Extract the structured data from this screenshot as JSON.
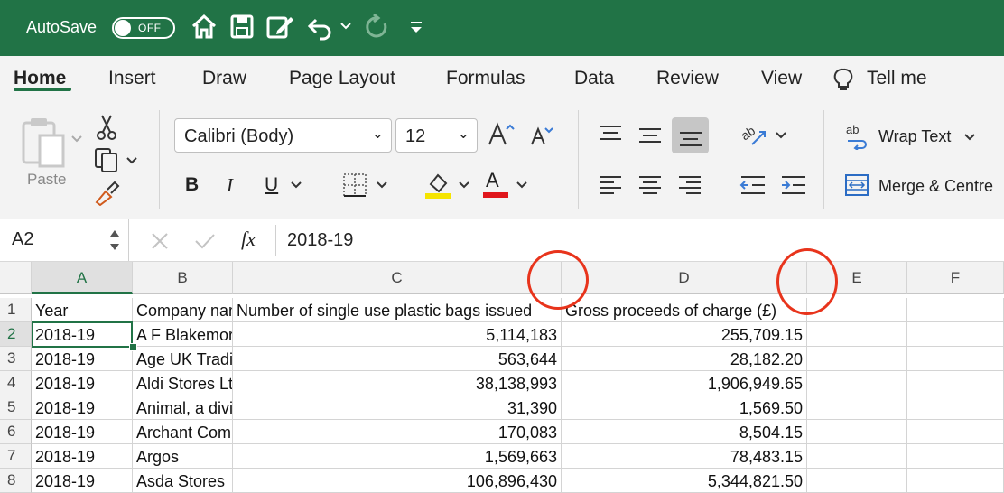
{
  "titlebar": {
    "autosave_label": "AutoSave",
    "autosave_state": "OFF",
    "quick_access_icons": [
      "home-icon",
      "save-icon",
      "edit-icon",
      "undo-icon",
      "redo-icon",
      "customize-icon"
    ]
  },
  "tabs": [
    "Home",
    "Insert",
    "Draw",
    "Page Layout",
    "Formulas",
    "Data",
    "Review",
    "View",
    "Tell me"
  ],
  "active_tab": "Home",
  "ribbon": {
    "paste_label": "Paste",
    "font_name": "Calibri (Body)",
    "font_size": "12",
    "wrap_text_label": "Wrap Text",
    "merge_label": "Merge & Centre",
    "bold": "B",
    "italic": "I",
    "underline": "U",
    "font_color_letter": "A",
    "highlight_color": "#f5e400",
    "font_color": "#e0161c"
  },
  "formula_bar": {
    "name_box": "A2",
    "fx": "fx",
    "value": "2018-19"
  },
  "sheet": {
    "columns": [
      "A",
      "B",
      "C",
      "D",
      "E",
      "F"
    ],
    "selected_column": "A",
    "rows": [
      {
        "num": "1",
        "cells": [
          "Year",
          "Company name",
          "Number of single use plastic bags issued",
          "Gross proceeds of charge (£)"
        ]
      },
      {
        "num": "2",
        "cells": [
          "2018-19",
          "A F Blakemore",
          "5,114,183",
          "255,709.15"
        ]
      },
      {
        "num": "3",
        "cells": [
          "2018-19",
          "Age UK Trading",
          "563,644",
          "28,182.20"
        ]
      },
      {
        "num": "4",
        "cells": [
          "2018-19",
          "Aldi Stores Ltd",
          "38,138,993",
          "1,906,949.65"
        ]
      },
      {
        "num": "5",
        "cells": [
          "2018-19",
          "Animal, a division",
          "31,390",
          "1,569.50"
        ]
      },
      {
        "num": "6",
        "cells": [
          "2018-19",
          "Archant Community",
          "170,083",
          "8,504.15"
        ]
      },
      {
        "num": "7",
        "cells": [
          "2018-19",
          "Argos",
          "1,569,663",
          "78,483.15"
        ]
      },
      {
        "num": "8",
        "cells": [
          "2018-19",
          "Asda Stores",
          "106,896,430",
          "5,344,821.50"
        ]
      }
    ],
    "selected_row": "2"
  },
  "annotation_color": "#e8341c"
}
